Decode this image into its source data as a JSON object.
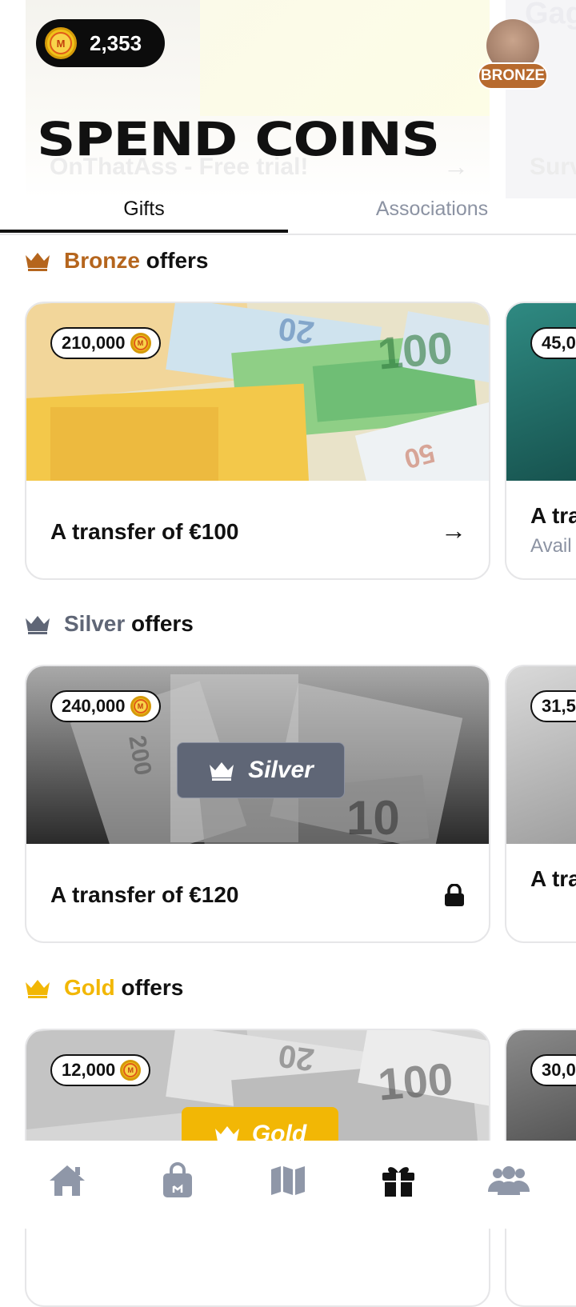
{
  "header": {
    "coin_balance": "2,353",
    "coin_symbol": "M",
    "rank_badge": "BRONZE",
    "page_title": "SPEND COINS"
  },
  "background_card": {
    "title": "OnThatAss - Free trial!",
    "arrow": "→",
    "second_title": "Surv",
    "second_brand": "Gag"
  },
  "tabs": [
    {
      "label": "Gifts",
      "active": true
    },
    {
      "label": "Associations",
      "active": false
    }
  ],
  "sections": {
    "bronze": {
      "level": "Bronze",
      "suffix": " offers",
      "color": "#b5651d"
    },
    "silver": {
      "level": "Silver",
      "suffix": " offers",
      "color": "#5f6676"
    },
    "gold": {
      "level": "Gold",
      "suffix": " offers",
      "color": "#f2b705"
    }
  },
  "offers": {
    "bronze_main": {
      "price": "210,000",
      "title": "A transfer of €100",
      "action": "→"
    },
    "bronze_peek": {
      "price": "45,0",
      "title": "A tra",
      "subtitle": "Avail"
    },
    "silver_main": {
      "price": "240,000",
      "title": "A transfer of €120",
      "locked_badge": "Silver",
      "locked": true
    },
    "silver_peek": {
      "price": "31,5",
      "title": "A tra"
    },
    "gold_main": {
      "price": "12,000",
      "locked_badge": "Gold",
      "locked": true
    },
    "gold_peek": {
      "price": "30,0"
    }
  },
  "bottom_nav": [
    {
      "icon": "home-icon",
      "active": false
    },
    {
      "icon": "shopping-bag-icon",
      "active": false
    },
    {
      "icon": "map-icon",
      "active": false
    },
    {
      "icon": "gift-icon",
      "active": true
    },
    {
      "icon": "users-icon",
      "active": false
    }
  ],
  "colors": {
    "nav_inactive": "#8f97a8",
    "nav_active": "#111111",
    "tab_inactive": "#8c93a3"
  }
}
